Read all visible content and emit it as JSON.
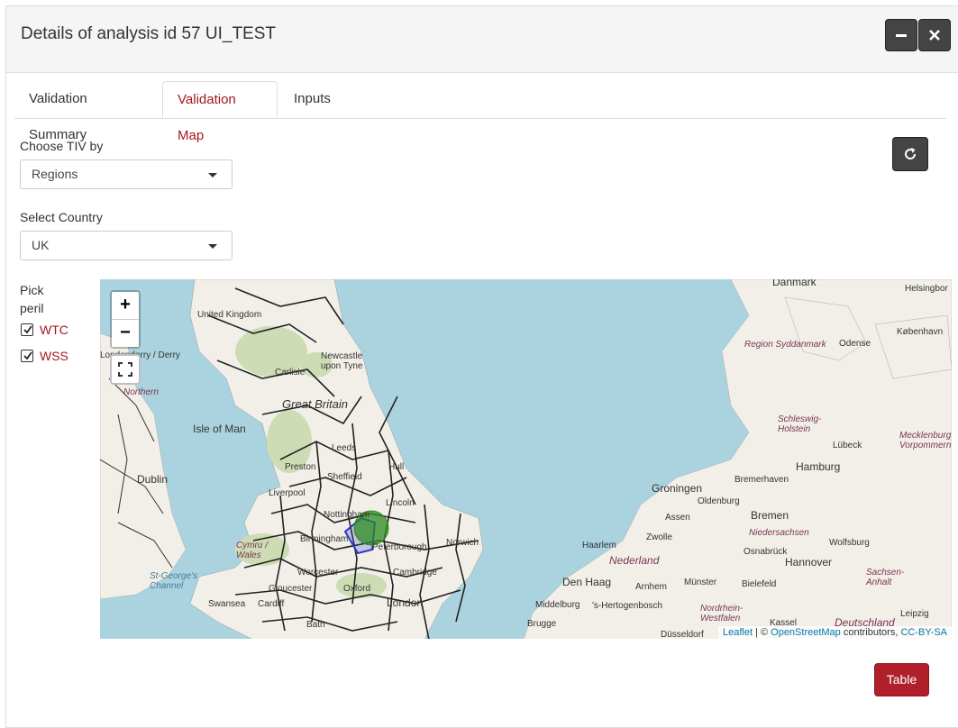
{
  "dialog": {
    "title": "Details of analysis id 57 UI_TEST"
  },
  "tabs": [
    {
      "label": "Validation Summary"
    },
    {
      "label": "Validation Map"
    },
    {
      "label": "Inputs"
    }
  ],
  "controls": {
    "tiv_label": "Choose TIV by",
    "tiv_value": "Regions",
    "country_label": "Select Country",
    "country_value": "UK",
    "peril_label_1": "Pick",
    "peril_label_2": "peril",
    "perils": [
      {
        "label": "WTC",
        "checked": true
      },
      {
        "label": "WSS",
        "checked": true
      }
    ]
  },
  "map": {
    "zoom_in": "+",
    "zoom_out": "−",
    "labels": {
      "denmark": "Danmark",
      "helsingborg": "Helsingbor",
      "kobenhavn": "København",
      "odense": "Odense",
      "syddanmark": "Region Syddanmark",
      "united_kingdom": "United Kingdom",
      "newcastle": "Newcastle upon Tyne",
      "carlisle": "Carlisle",
      "great_britain": "Great Britain",
      "isle_of_man": "Isle of Man",
      "dublin": "Dublin",
      "leeds": "Leeds",
      "hull": "Hull",
      "preston": "Preston",
      "sheffield": "Sheffield",
      "liverpool": "Liverpool",
      "lincoln": "Lincoln",
      "nottingham": "Nottingham",
      "birmingham": "Birmingham",
      "peterborough": "Peterborough",
      "norwich": "Norwich",
      "cambridge": "Cambridge",
      "worcester": "Worcester",
      "gloucester": "Gloucester",
      "oxford": "Oxford",
      "london": "London",
      "swansea": "Swansea",
      "bath": "Bath",
      "cardiff": "Cardiff",
      "stgeorge": "St-George's Channel",
      "cymru": "Cymru / Wales",
      "lubeck": "Lübeck",
      "hamburg": "Hamburg",
      "schleswig": "Schleswig-Holstein",
      "mecklenburg": "Mecklenburg Vorpommern",
      "bremerhaven": "Bremerhaven",
      "groningen": "Groningen",
      "oldenburg": "Oldenburg",
      "bremen": "Bremen",
      "assen": "Assen",
      "zwolle": "Zwolle",
      "niedersachsen": "Niedersachsen",
      "osnabruck": "Osnabrück",
      "wolfsburg": "Wolfsburg",
      "haarlem": "Haarlem",
      "nederland": "Nederland",
      "hannover": "Hannover",
      "den_haag": "Den Haag",
      "arnhem": "Arnhem",
      "munster": "Münster",
      "bielefeld": "Bielefeld",
      "sachsen_anhalt": "Sachsen-Anhalt",
      "middelburg": "Middelburg",
      "shertogenbosch": "'s-Hertogenbosch",
      "nordrhein": "Nordrhein-Westfalen",
      "brugge": "Brugge",
      "dusseldorf": "Düsseldorf",
      "kassel": "Kassel",
      "deutschland": "Deutschland",
      "leipzig": "Leipzig",
      "londonderry": "Londonderry / Derry",
      "northern": "Northern"
    },
    "attribution": {
      "leaflet": "Leaflet",
      "sep": " | © ",
      "osm": "OpenStreetMap",
      "contributors": " contributors, ",
      "license": "CC-BY-SA"
    },
    "colors": {
      "water": "#aad3df",
      "land": "#f2efe9",
      "marker": "#2e8b22"
    }
  },
  "footer": {
    "table_button": "Table"
  }
}
